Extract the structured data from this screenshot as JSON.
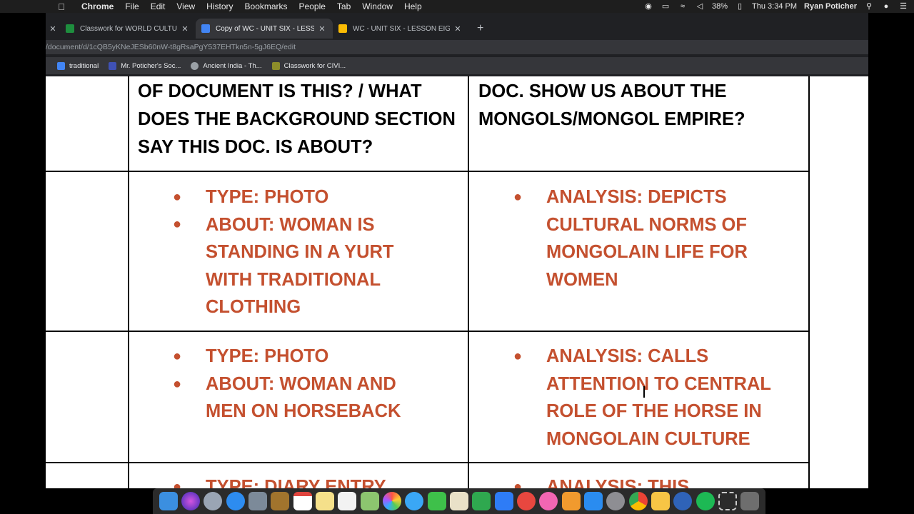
{
  "menubar": {
    "app": "Chrome",
    "items": [
      "File",
      "Edit",
      "View",
      "History",
      "Bookmarks",
      "People",
      "Tab",
      "Window",
      "Help"
    ],
    "battery": "38%",
    "clock": "Thu 3:34 PM",
    "user": "Ryan Poticher"
  },
  "tabs": [
    {
      "label": "Classwork for WORLD CULTUR",
      "color": "#1e8e3e",
      "active": false
    },
    {
      "label": "Copy of WC - UNIT SIX - LESS",
      "color": "#4285f4",
      "active": true
    },
    {
      "label": "WC - UNIT SIX - LESSON EIGH",
      "color": "#fbbc04",
      "active": false
    }
  ],
  "url": "/document/d/1cQB5yKNeJESb60nW-t8gRsaPgY537EHTkn5n-5gJ6EQ/edit",
  "bookmarks": [
    {
      "label": "traditional",
      "color": "#4285f4"
    },
    {
      "label": "Mr. Poticher's Soc...",
      "color": "#3f51b5"
    },
    {
      "label": "Ancient India - Th...",
      "color": "#9aa0a6"
    },
    {
      "label": "Classwork for CIVI...",
      "color": "#8d8d2a"
    }
  ],
  "table": {
    "header_left": [
      "OF DOCUMENT IS THIS? / WHAT",
      "DOES THE BACKGROUND SECTION",
      "SAY THIS DOC. IS ABOUT?"
    ],
    "header_right": [
      "DOC. SHOW US ABOUT THE",
      "MONGOLS/MONGOL EMPIRE?"
    ],
    "row1_left": {
      "b1": "TYPE:  PHOTO",
      "b2": [
        "ABOUT:  WOMAN IS",
        "STANDING IN A YURT",
        "WITH TRADITIONAL",
        "CLOTHING"
      ]
    },
    "row1_right": [
      "ANALYSIS: DEPICTS",
      "CULTURAL NORMS OF",
      "MONGOLAIN LIFE FOR",
      "WOMEN"
    ],
    "row2_left": {
      "b1": "TYPE: PHOTO",
      "b2": [
        "ABOUT:  WOMAN AND",
        "MEN ON HORSEBACK"
      ]
    },
    "row2_right": [
      "ANALYSIS: CALLS",
      "ATTENTION TO CENTRAL",
      "ROLE OF THE HORSE IN",
      "MONGOLAIN CULTURE"
    ],
    "row3_left": "TYPE:  DIARY ENTRY",
    "row3_right": "ANALYSIS: THIS"
  },
  "accent_color": "#c4502f",
  "dock_icons": [
    "finder-icon",
    "siri-icon",
    "launchpad-icon",
    "safari-icon",
    "photos-viewer-icon",
    "notebook-icon",
    "calendar-icon",
    "notes-icon",
    "reminders-icon",
    "maps-icon",
    "photos-icon",
    "messages-icon",
    "facetime-icon",
    "preview-icon",
    "numbers-icon",
    "keynote-icon",
    "news-icon",
    "music-icon",
    "books-icon",
    "app-store-icon",
    "system-preferences-icon",
    "chrome-icon",
    "folder-icon",
    "mendeley-icon",
    "spotify-icon",
    "screenshot-icon",
    "trash-icon"
  ]
}
